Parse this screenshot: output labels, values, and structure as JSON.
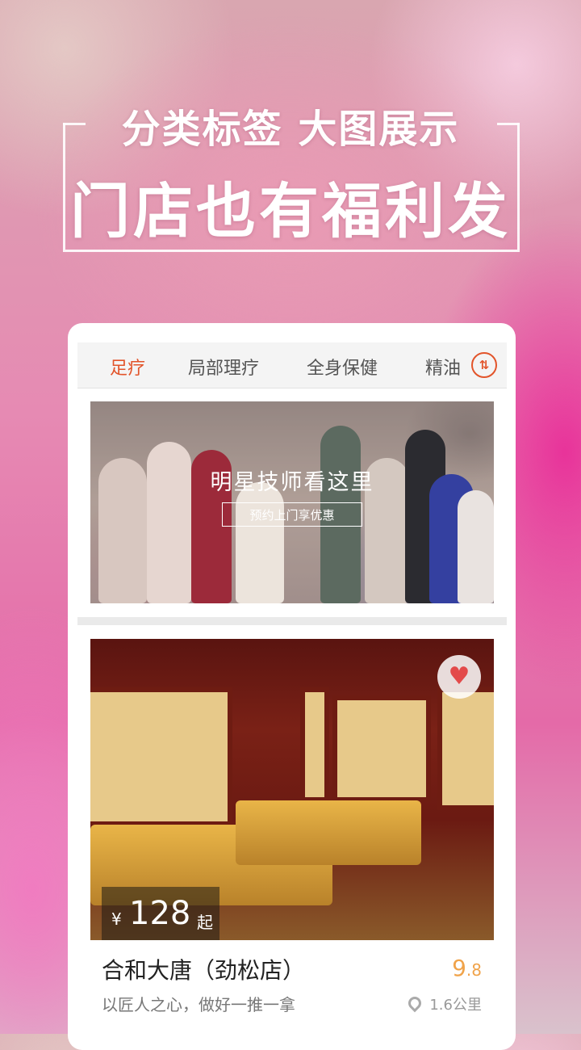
{
  "hero": {
    "line1": "分类标签 大图展示",
    "line2": "门店也有福利发"
  },
  "tabs": [
    {
      "label": "足疗",
      "active": true
    },
    {
      "label": "局部理疗",
      "active": false
    },
    {
      "label": "全身保健",
      "active": false
    },
    {
      "label": "精油",
      "active": false
    }
  ],
  "sort_icon": "sort-arrows-icon",
  "banner": {
    "title": "明星技师看这里",
    "button": "预约上门享优惠"
  },
  "shop": {
    "price_symbol": "¥",
    "price": "128",
    "price_suffix": "起",
    "name": "合和大唐（劲松店）",
    "score_main": "9",
    "score_decimal": ".8",
    "slogan": "以匠人之心，做好一推一拿",
    "distance": "1.6公里",
    "favorite_icon": "heart-icon",
    "location_icon": "location-pin-icon"
  },
  "colors": {
    "accent": "#e2542a",
    "score": "#f0a34a",
    "favorite": "#e34a4a"
  }
}
